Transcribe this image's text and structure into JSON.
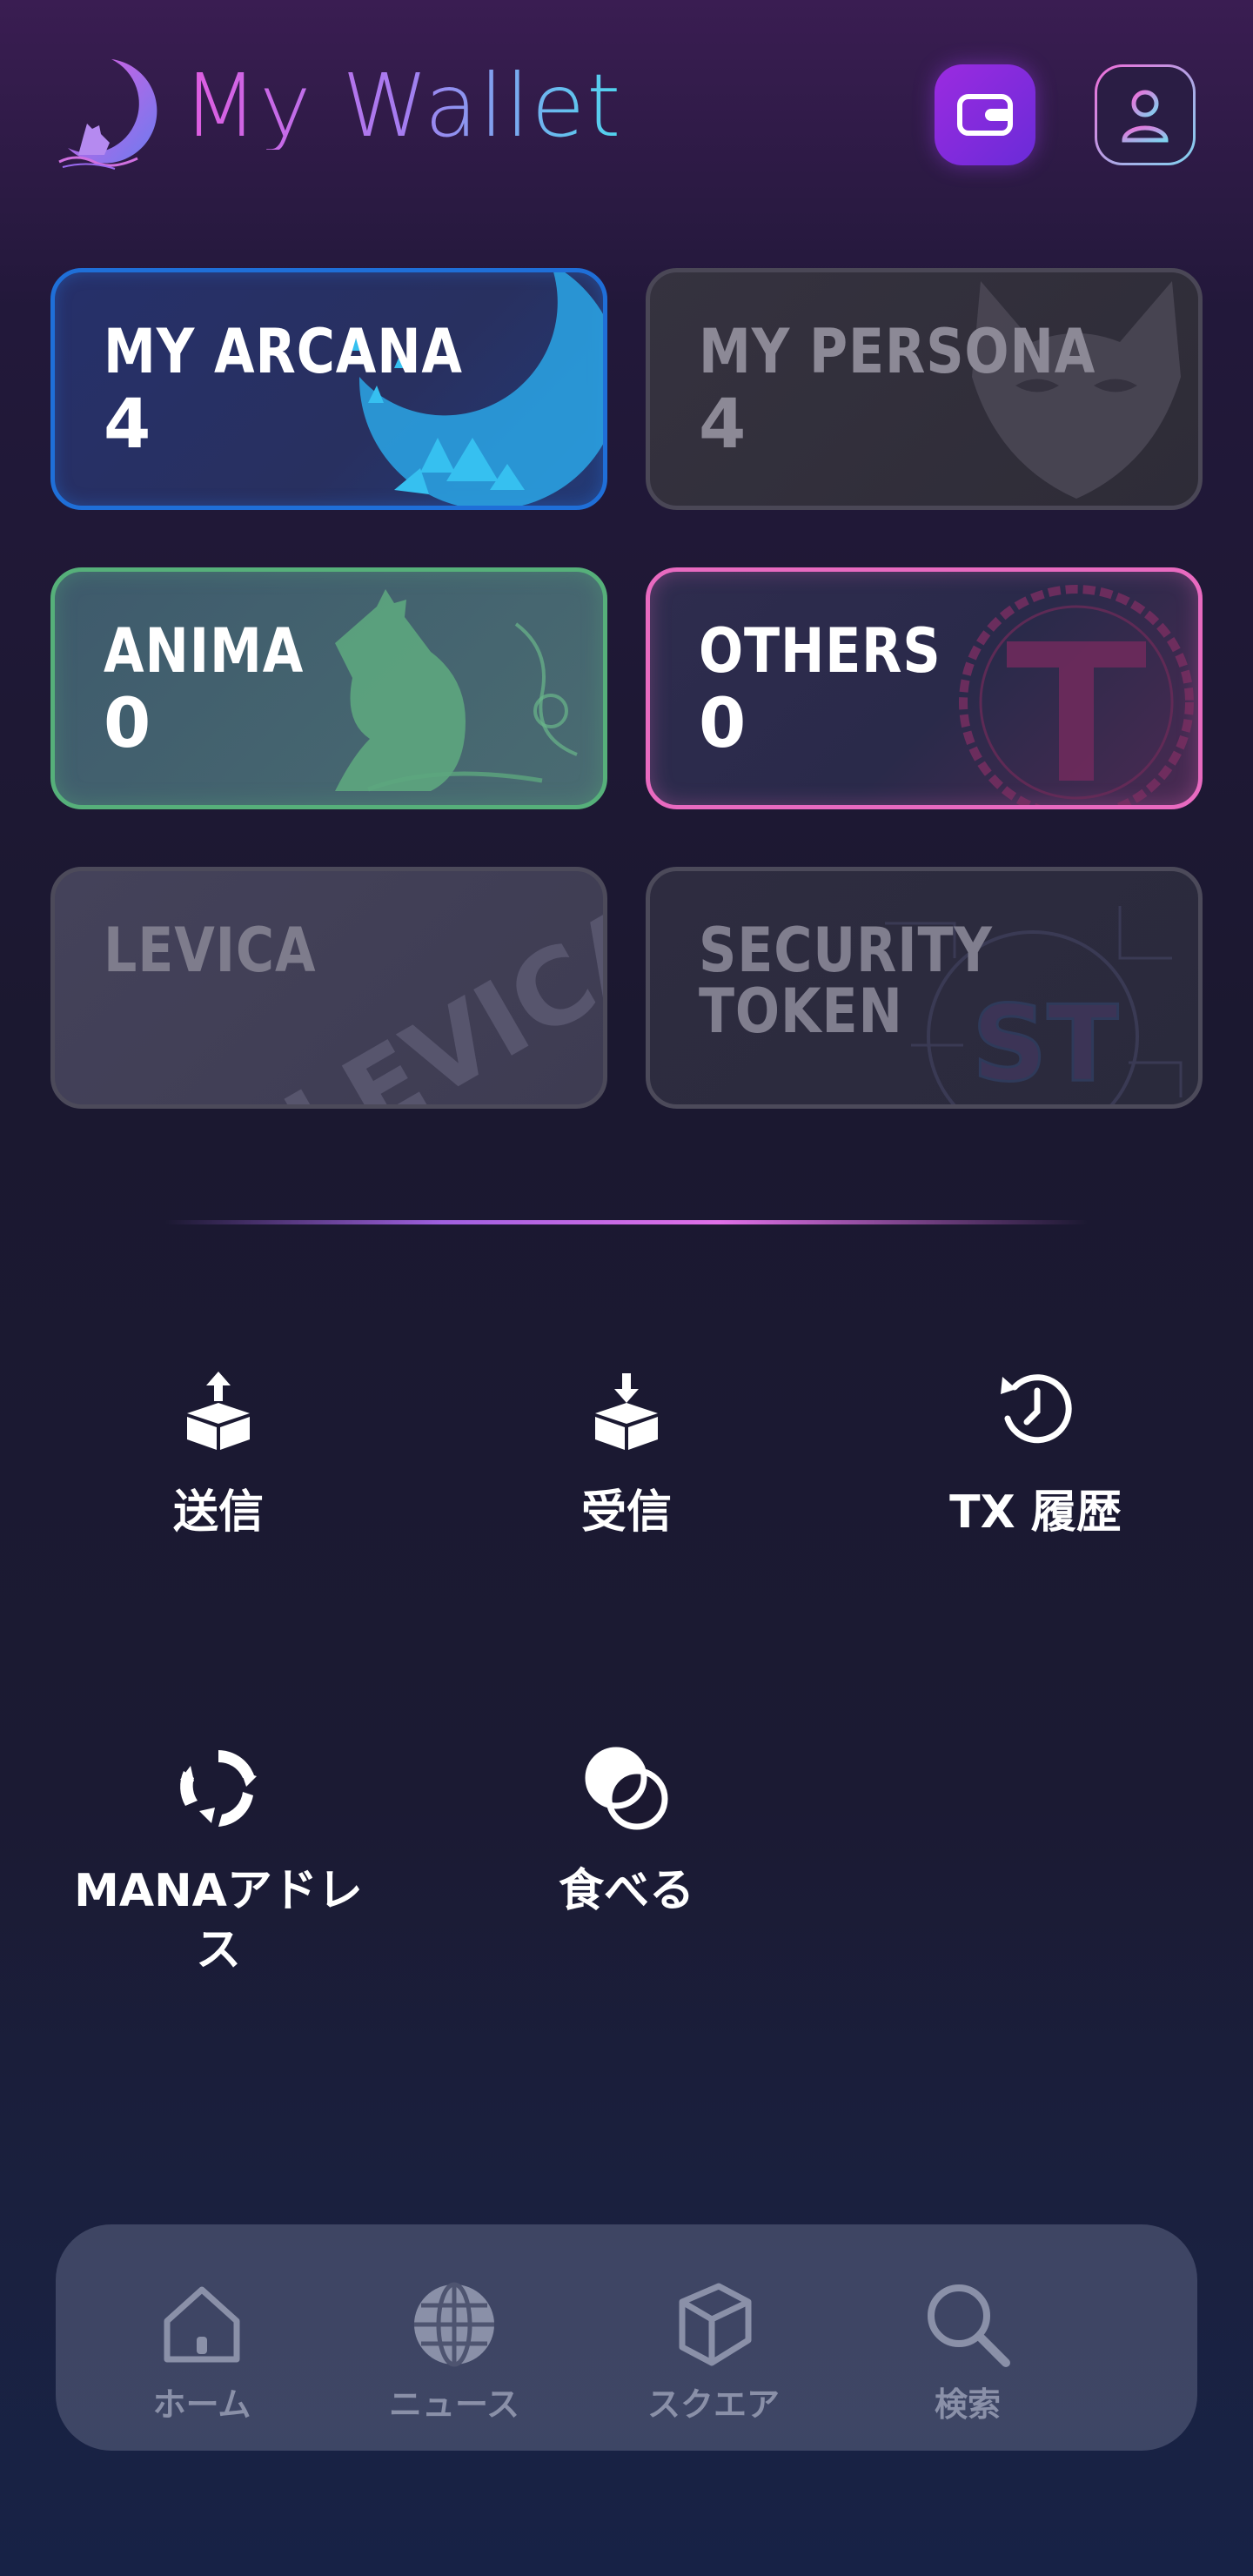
{
  "header": {
    "title": "My Wallet",
    "logo_icon": "moon-cat-logo-icon",
    "wallet_icon": "wallet-icon",
    "account_icon": "user-icon"
  },
  "cards": {
    "arcana": {
      "title": "MY ARCANA",
      "count": "4",
      "color": "#1f6fd8"
    },
    "persona": {
      "title": "MY PERSONA",
      "count": "4",
      "color": "#4a4756"
    },
    "anima": {
      "title": "ANIMA",
      "count": "0",
      "color": "#56b07a"
    },
    "others": {
      "title": "OTHERS",
      "count": "0",
      "color": "#e86ac0"
    },
    "levica": {
      "title": "LEVICA",
      "watermark": "LEVICA",
      "color": "#4c4a5a"
    },
    "security": {
      "title": "SECURITY TOKEN",
      "watermark": "ST",
      "color": "#4c4a5a"
    }
  },
  "actions": {
    "send": {
      "label": "送信",
      "icon": "box-upload-icon"
    },
    "receive": {
      "label": "受信",
      "icon": "box-download-icon"
    },
    "history": {
      "label": "TX 履歴",
      "icon": "clock-history-icon"
    },
    "mana": {
      "label": "MANAアドレス",
      "icon": "recycle-icon"
    },
    "eat": {
      "label": "食べる",
      "icon": "overlap-circles-icon"
    }
  },
  "nav": {
    "home": {
      "label": "ホーム",
      "icon": "home-icon"
    },
    "news": {
      "label": "ニュース",
      "icon": "globe-icon"
    },
    "square": {
      "label": "スクエア",
      "icon": "cube-icon"
    },
    "search": {
      "label": "検索",
      "icon": "search-icon"
    }
  }
}
